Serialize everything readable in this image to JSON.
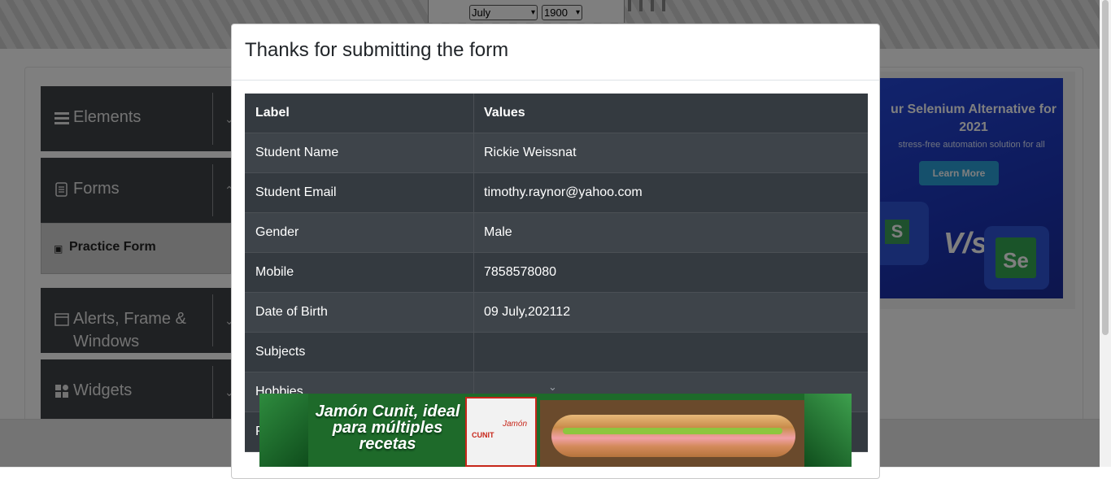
{
  "background": {
    "date_month": "July",
    "date_year": "1900",
    "sidebar": {
      "groups": [
        {
          "label": "Elements",
          "icon": "hamburger-icon"
        },
        {
          "label": "Forms",
          "icon": "document-icon"
        },
        {
          "label": "Alerts, Frame & Windows",
          "icon": "window-icon"
        },
        {
          "label": "Widgets",
          "icon": "widgets-grid-icon"
        }
      ],
      "active_item": "Practice Form"
    },
    "ad_right": {
      "headline": "ur Selenium Alternative for 2021",
      "subline": "stress-free automation solution for all",
      "button": "Learn More",
      "vs": "V/s",
      "badge_left": "S",
      "badge_right": "Se"
    },
    "ad_bottom": {
      "slogan": "Jamón Cunit, ideal para múltiples recetas",
      "pack_brand": "CUNIT",
      "pack_label": "Jamón"
    }
  },
  "modal": {
    "title": "Thanks for submitting the form",
    "table": {
      "headers": [
        "Label",
        "Values"
      ],
      "rows": [
        {
          "label": "Student Name",
          "value": "Rickie Weissnat"
        },
        {
          "label": "Student Email",
          "value": "timothy.raynor@yahoo.com"
        },
        {
          "label": "Gender",
          "value": "Male"
        },
        {
          "label": "Mobile",
          "value": "7858578080"
        },
        {
          "label": "Date of Birth",
          "value": "09 July,202112"
        },
        {
          "label": "Subjects",
          "value": ""
        },
        {
          "label": "Hobbies",
          "value": ""
        },
        {
          "label": "P",
          "value": ""
        }
      ]
    }
  },
  "colors": {
    "table_dark": "#343a40",
    "table_light": "#3e444a",
    "sidebar": "#3f4347",
    "ad_blue": "#2447d8"
  }
}
